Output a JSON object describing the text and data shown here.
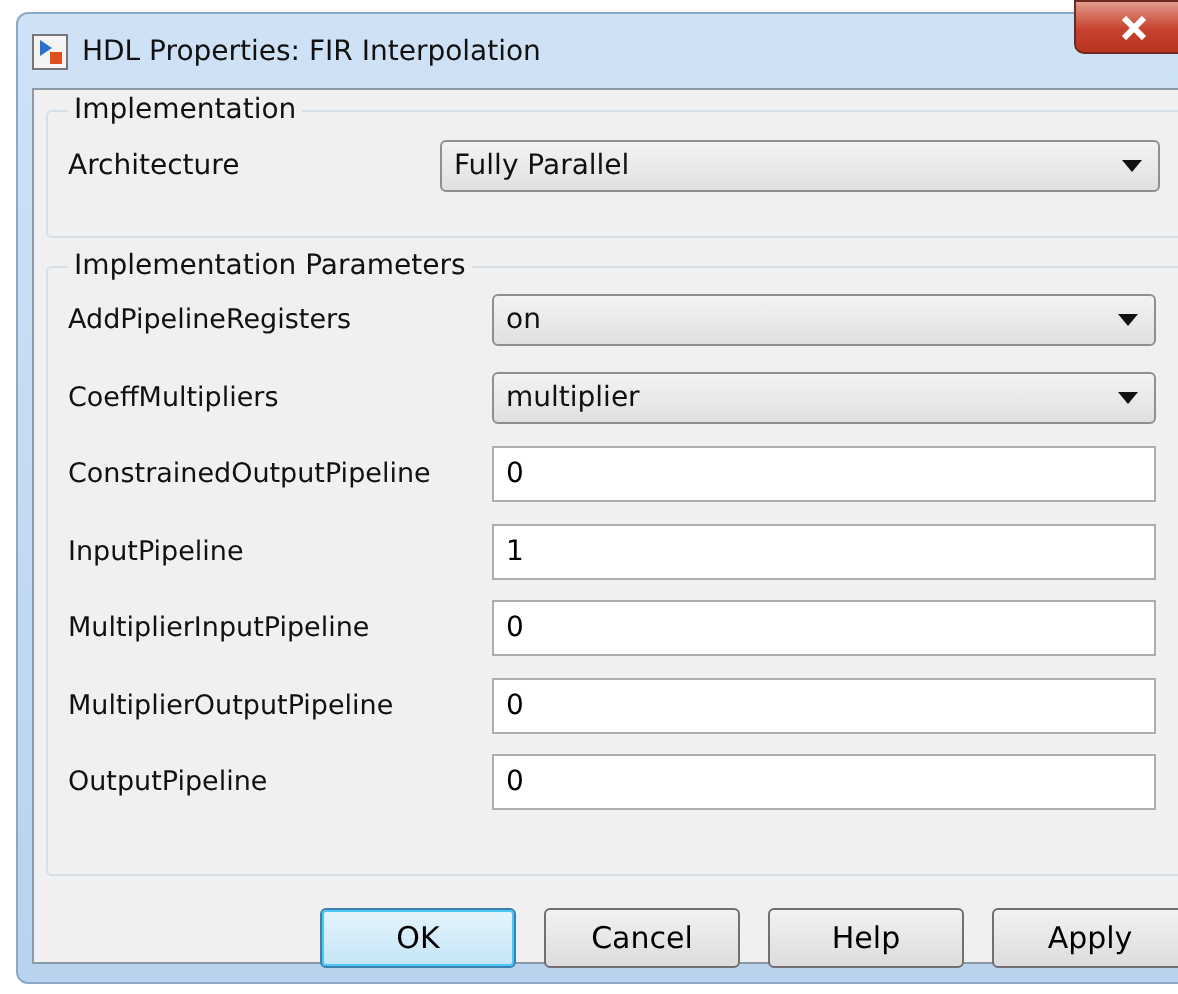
{
  "window": {
    "title": "HDL Properties: FIR Interpolation"
  },
  "implementation": {
    "legend": "Implementation",
    "architecture": {
      "label": "Architecture",
      "value": "Fully Parallel"
    }
  },
  "parameters": {
    "legend": "Implementation Parameters",
    "rows": [
      {
        "label": "AddPipelineRegisters",
        "kind": "select",
        "value": "on"
      },
      {
        "label": "CoeffMultipliers",
        "kind": "select",
        "value": "multiplier"
      },
      {
        "label": "ConstrainedOutputPipeline",
        "kind": "text",
        "value": "0"
      },
      {
        "label": "InputPipeline",
        "kind": "text",
        "value": "1"
      },
      {
        "label": "MultiplierInputPipeline",
        "kind": "text",
        "value": "0"
      },
      {
        "label": "MultiplierOutputPipeline",
        "kind": "text",
        "value": "0"
      },
      {
        "label": "OutputPipeline",
        "kind": "text",
        "value": "0"
      }
    ]
  },
  "buttons": [
    {
      "label": "OK",
      "default": true
    },
    {
      "label": "Cancel",
      "default": false
    },
    {
      "label": "Help",
      "default": false
    },
    {
      "label": "Apply",
      "default": false
    }
  ]
}
